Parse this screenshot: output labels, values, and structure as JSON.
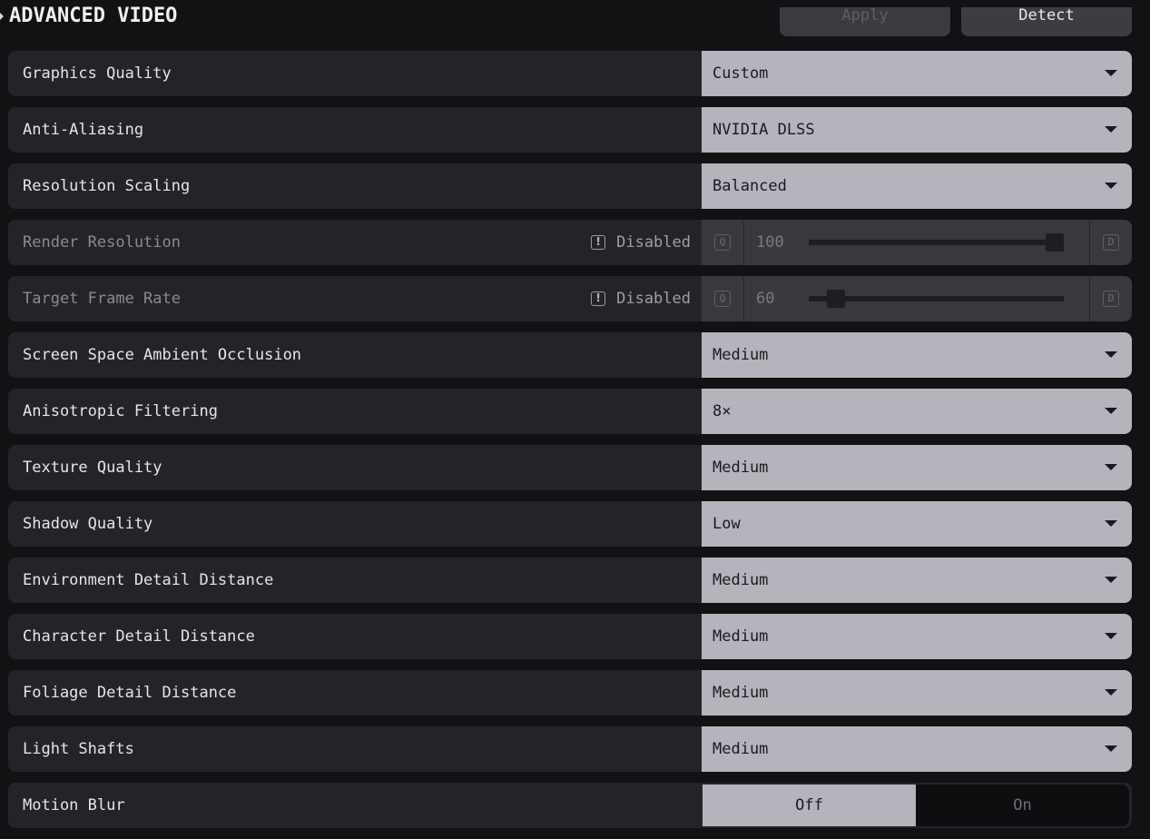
{
  "header": {
    "title": "ADVANCED VIDEO",
    "apply_label": "Apply",
    "detect_label": "Detect"
  },
  "settings": [
    {
      "label": "Graphics Quality",
      "value": "Custom"
    },
    {
      "label": "Anti-Aliasing",
      "value": "NVIDIA DLSS"
    },
    {
      "label": "Resolution Scaling",
      "value": "Balanced"
    },
    {
      "label": "Render Resolution",
      "disabled_text": "Disabled",
      "value": "100",
      "key_left": "Q",
      "key_right": "D",
      "slider_fraction": 1.0
    },
    {
      "label": "Target Frame Rate",
      "disabled_text": "Disabled",
      "value": "60",
      "key_left": "Q",
      "key_right": "D",
      "slider_fraction": 0.04
    },
    {
      "label": "Screen Space Ambient Occlusion",
      "value": "Medium"
    },
    {
      "label": "Anisotropic Filtering",
      "value": "8×"
    },
    {
      "label": "Texture Quality",
      "value": "Medium"
    },
    {
      "label": "Shadow Quality",
      "value": "Low"
    },
    {
      "label": "Environment Detail Distance",
      "value": "Medium"
    },
    {
      "label": "Character Detail Distance",
      "value": "Medium"
    },
    {
      "label": "Foliage Detail Distance",
      "value": "Medium"
    },
    {
      "label": "Light Shafts",
      "value": "Medium"
    },
    {
      "label": "Motion Blur",
      "off_label": "Off",
      "on_label": "On",
      "selected": "Off"
    }
  ]
}
